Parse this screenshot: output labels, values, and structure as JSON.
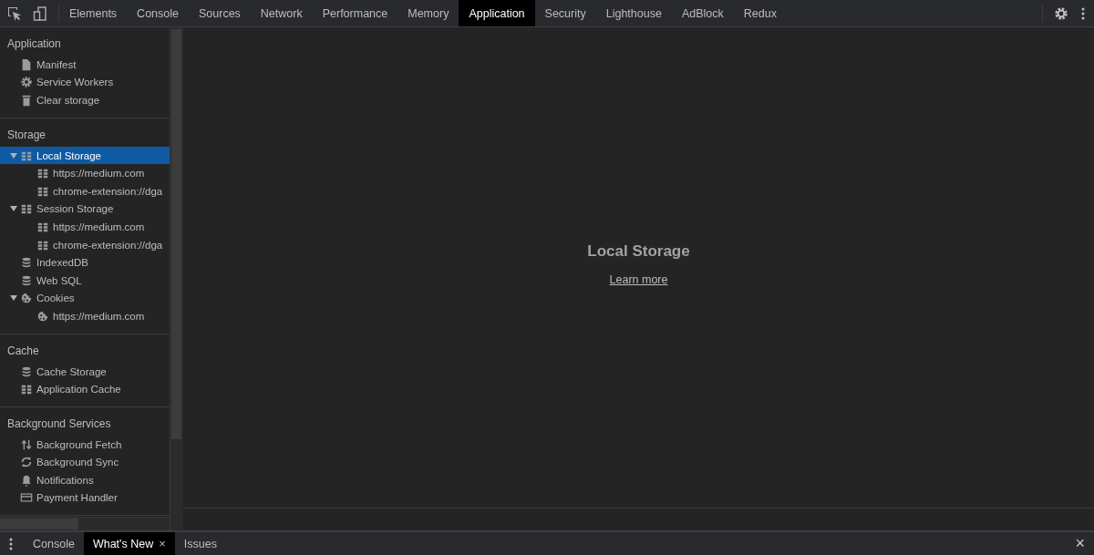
{
  "toolbar": {
    "tabs": [
      {
        "label": "Elements",
        "selected": false
      },
      {
        "label": "Console",
        "selected": false
      },
      {
        "label": "Sources",
        "selected": false
      },
      {
        "label": "Network",
        "selected": false
      },
      {
        "label": "Performance",
        "selected": false
      },
      {
        "label": "Memory",
        "selected": false
      },
      {
        "label": "Application",
        "selected": true
      },
      {
        "label": "Security",
        "selected": false
      },
      {
        "label": "Lighthouse",
        "selected": false
      },
      {
        "label": "AdBlock",
        "selected": false
      },
      {
        "label": "Redux",
        "selected": false
      }
    ]
  },
  "sidebar": {
    "sections": [
      {
        "title": "Application",
        "items": [
          {
            "label": "Manifest",
            "kind": "file",
            "selected": false
          },
          {
            "label": "Service Workers",
            "kind": "gear",
            "selected": false
          },
          {
            "label": "Clear storage",
            "kind": "trash",
            "selected": false
          }
        ]
      },
      {
        "title": "Storage",
        "items": [
          {
            "label": "Local Storage",
            "kind": "table",
            "selected": true,
            "expanded": true,
            "children": [
              {
                "label": "https://medium.com",
                "kind": "table",
                "selected": false
              },
              {
                "label": "chrome-extension://dga",
                "kind": "table",
                "selected": false
              }
            ]
          },
          {
            "label": "Session Storage",
            "kind": "table",
            "selected": false,
            "expanded": true,
            "children": [
              {
                "label": "https://medium.com",
                "kind": "table",
                "selected": false
              },
              {
                "label": "chrome-extension://dga",
                "kind": "table",
                "selected": false
              }
            ]
          },
          {
            "label": "IndexedDB",
            "kind": "db",
            "selected": false
          },
          {
            "label": "Web SQL",
            "kind": "db",
            "selected": false
          },
          {
            "label": "Cookies",
            "kind": "cookie",
            "selected": false,
            "expanded": true,
            "children": [
              {
                "label": "https://medium.com",
                "kind": "cookie",
                "selected": false
              }
            ]
          }
        ]
      },
      {
        "title": "Cache",
        "items": [
          {
            "label": "Cache Storage",
            "kind": "db",
            "selected": false
          },
          {
            "label": "Application Cache",
            "kind": "table",
            "selected": false
          }
        ]
      },
      {
        "title": "Background Services",
        "items": [
          {
            "label": "Background Fetch",
            "kind": "updown",
            "selected": false
          },
          {
            "label": "Background Sync",
            "kind": "sync",
            "selected": false
          },
          {
            "label": "Notifications",
            "kind": "bell",
            "selected": false
          },
          {
            "label": "Payment Handler",
            "kind": "card",
            "selected": false
          }
        ]
      }
    ]
  },
  "main": {
    "title": "Local Storage",
    "link": "Learn more"
  },
  "drawer": {
    "tabs": [
      {
        "label": "Console",
        "selected": false
      },
      {
        "label": "What's New",
        "selected": true,
        "close": "×"
      },
      {
        "label": "Issues",
        "selected": false
      }
    ],
    "close": "×"
  }
}
